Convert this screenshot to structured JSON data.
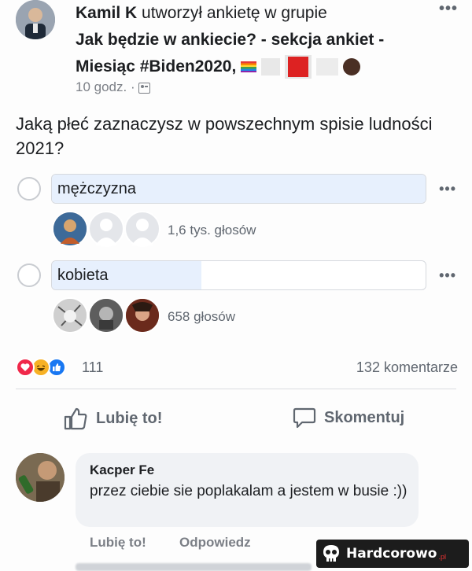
{
  "post": {
    "author": "Kamil K",
    "action_text": "utworzył ankietę w grupie",
    "group_name": "Jak będzie w ankiecie? - sekcja ankiet - Miesiąc #Biden2020,",
    "timestamp": "10 godz. ·",
    "more_label": "•••"
  },
  "poll": {
    "question": "Jaką płeć zaznaczysz w powszechnym spisie ludności 2021?",
    "options": [
      {
        "label": "mężczyzna",
        "votes": "1,6 tys. głosów",
        "share": 1.0
      },
      {
        "label": "kobieta",
        "votes": "658 głosów",
        "share": 0.4
      }
    ],
    "option_more": "•••"
  },
  "reactions": {
    "count": "111",
    "comments": "132 komentarze"
  },
  "actions": {
    "like": "Lubię to!",
    "comment": "Skomentuj"
  },
  "comment": {
    "author": "Kacper Fe",
    "text": "przez ciebie sie poplakalam a jestem w busie :))",
    "like": "Lubię to!",
    "reply": "Odpowiedz"
  },
  "watermark": {
    "text": "Hardcorowo",
    "suffix": ".pl"
  },
  "colors": {
    "poll_fill": "#e7f0fd",
    "reaction_love": "#f0284a",
    "reaction_haha": "#f7b125",
    "reaction_like": "#1877f2"
  }
}
